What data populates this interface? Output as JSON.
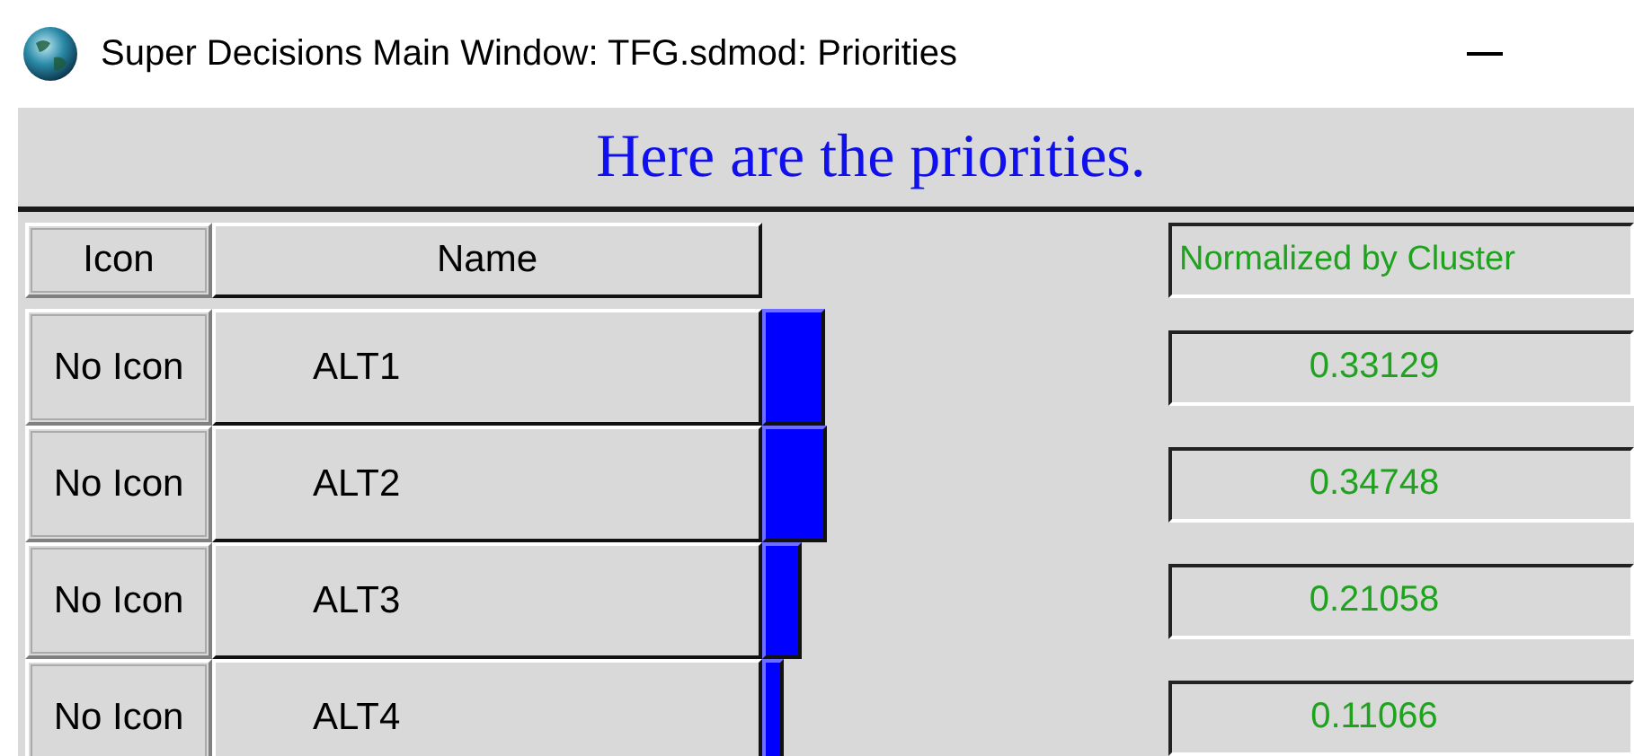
{
  "window": {
    "title": "Super Decisions Main Window: TFG.sdmod: Priorities"
  },
  "heading": "Here are the priorities.",
  "table": {
    "columns": [
      "Icon",
      "Name",
      "Normalized by Cluster"
    ],
    "rows": [
      {
        "icon": "No Icon",
        "name": "ALT1",
        "value": "0.33129"
      },
      {
        "icon": "No Icon",
        "name": "ALT2",
        "value": "0.34748"
      },
      {
        "icon": "No Icon",
        "name": "ALT3",
        "value": "0.21058"
      },
      {
        "icon": "No Icon",
        "name": "ALT4",
        "value": "0.11066"
      }
    ]
  }
}
